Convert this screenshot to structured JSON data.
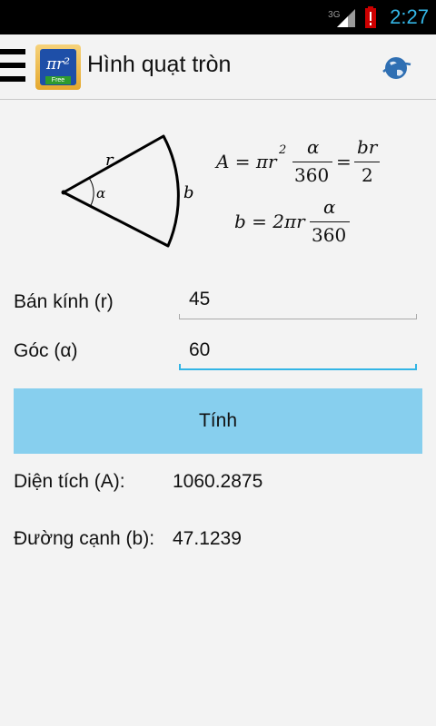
{
  "status_bar": {
    "network_label": "3G",
    "time": "2:27",
    "icons": [
      "signal-icon",
      "battery-alert-icon"
    ]
  },
  "action_bar": {
    "title": "Hình quạt tròn",
    "app_icon_text": "πr²",
    "app_icon_badge": "Free",
    "icons": [
      "menu-icon",
      "app-icon",
      "globe-icon"
    ]
  },
  "diagram": {
    "radius_label": "r",
    "angle_label": "α",
    "arc_label": "b"
  },
  "formulas": {
    "area_formula": "A = πr² α/360 = br/2",
    "arc_formula": "b = 2πr α/360"
  },
  "form": {
    "radius_label": "Bán kính (r)",
    "radius_value": "45",
    "angle_label": "Góc (α)",
    "angle_value": "60",
    "calculate_button": "Tính"
  },
  "results": {
    "area_label": "Diện tích (A):",
    "area_value": "1060.2875",
    "arc_label": "Đường cạnh (b):",
    "arc_value": "47.1239"
  },
  "colors": {
    "accent": "#33b5e5",
    "button": "#87cfee",
    "background": "#f3f3f3"
  }
}
